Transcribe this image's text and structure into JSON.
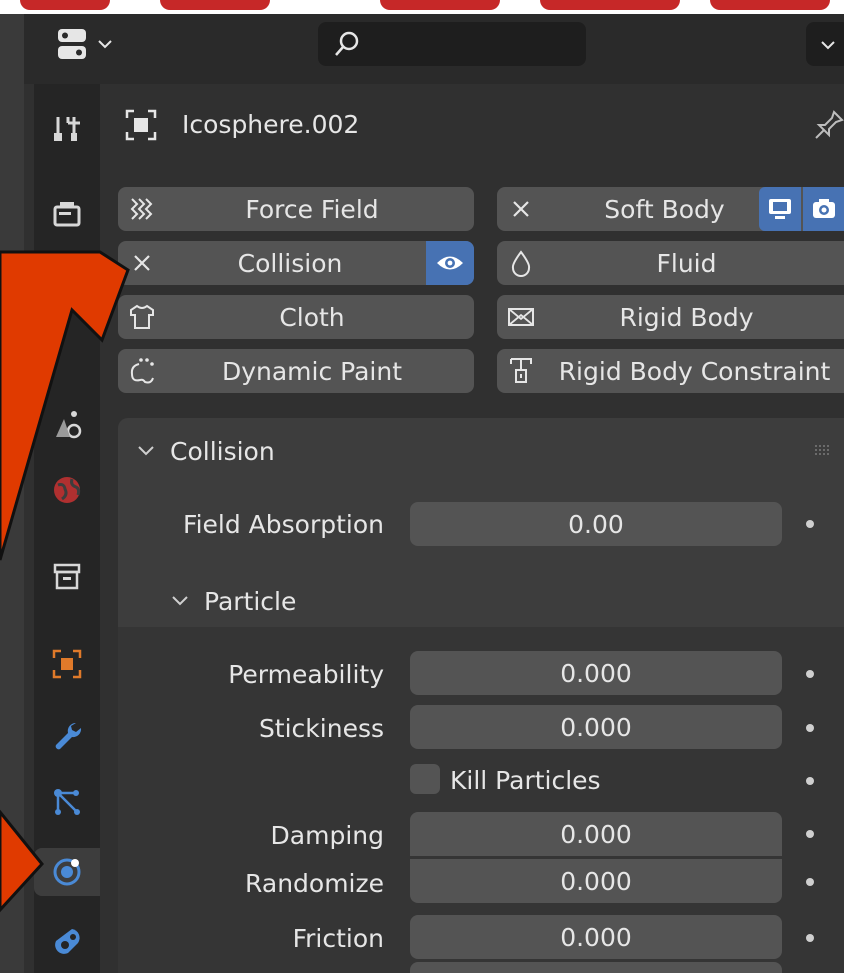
{
  "object": {
    "name": "Icosphere.002"
  },
  "physics_buttons": [
    {
      "label": "Force Field",
      "icon": "force-field-icon",
      "enabled": false
    },
    {
      "label": "Soft Body",
      "icon": "close-icon",
      "enabled": true
    },
    {
      "label": "Collision",
      "icon": "close-icon",
      "enabled": true
    },
    {
      "label": "Fluid",
      "icon": "fluid-drop-icon",
      "enabled": false
    },
    {
      "label": "Cloth",
      "icon": "cloth-shirt-icon",
      "enabled": false
    },
    {
      "label": "Rigid Body",
      "icon": "rigid-body-icon",
      "enabled": false
    },
    {
      "label": "Dynamic Paint",
      "icon": "dynamic-paint-icon",
      "enabled": false
    },
    {
      "label": "Rigid Body Constraint",
      "icon": "constraint-icon",
      "enabled": false
    }
  ],
  "collision_panel": {
    "title": "Collision",
    "field_absorption": {
      "label": "Field Absorption",
      "value": "0.00"
    },
    "particle": {
      "title": "Particle",
      "permeability": {
        "label": "Permeability",
        "value": "0.000"
      },
      "stickiness": {
        "label": "Stickiness",
        "value": "0.000"
      },
      "kill_particles": {
        "label": "Kill Particles",
        "checked": false
      },
      "damping": {
        "label": "Damping",
        "value": "0.000"
      },
      "randomize": {
        "label": "Randomize",
        "value": "0.000"
      },
      "friction": {
        "label": "Friction",
        "value": "0.000"
      }
    }
  },
  "colors": {
    "accent": "#4772b3",
    "highlight": "#e03a00",
    "button": "#545454",
    "panel": "#3d3d3d"
  }
}
